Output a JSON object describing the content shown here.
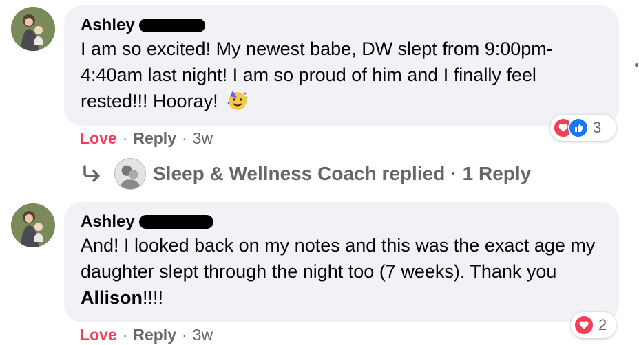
{
  "comments": [
    {
      "author": "Ashley",
      "text": "I am so excited! My newest babe, DW slept from 9:00pm-4:40am last night! I am so proud of him and I finally feel rested!!! Hooray!",
      "emoji": "partying-face-icon",
      "reaction_count": "3",
      "reactions": [
        "love",
        "like"
      ],
      "actions": {
        "love": "Love",
        "reply": "Reply",
        "time": "3w"
      }
    },
    {
      "author": "Ashley",
      "text_before": "And! I looked back on my notes and this was the exact age my daughter slept through the night too (7 weeks). Thank you ",
      "text_bold": "Allison",
      "text_after": "!!!!",
      "reaction_count": "2",
      "reactions": [
        "love"
      ],
      "actions": {
        "love": "Love",
        "reply": "Reply",
        "time": "3w"
      }
    }
  ],
  "replies": {
    "author": "Sleep & Wellness Coach replied",
    "count": "1 Reply"
  },
  "colors": {
    "love": "#f33e58",
    "like": "#1877f2",
    "muted": "#65676b",
    "bubble": "#f0f2f5"
  }
}
